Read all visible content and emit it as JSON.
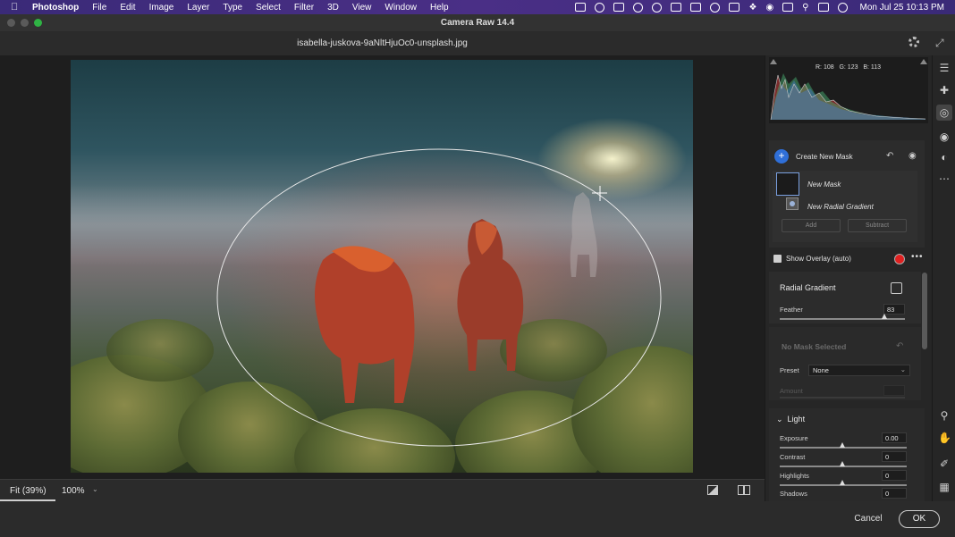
{
  "menubar": {
    "app": "Photoshop",
    "menus": [
      "File",
      "Edit",
      "Image",
      "Layer",
      "Type",
      "Select",
      "Filter",
      "3D",
      "View",
      "Window",
      "Help"
    ],
    "clock": "Mon Jul 25  10:13 PM",
    "status_icons": [
      "screen-record-icon",
      "creative-cloud-icon",
      "dropbox-icon",
      "vpn-icon",
      "sync-icon",
      "cast-icon",
      "bookmark-icon",
      "arc-icon",
      "grid-app-icon",
      "bluetooth-icon",
      "wifi-icon",
      "display-icon",
      "search-icon",
      "control-center-icon",
      "siri-icon"
    ]
  },
  "window": {
    "title": "Camera Raw 14.4",
    "filename": "isabella-juskova-9aNltHjuOc0-unsplash.jpg"
  },
  "canvas_footer": {
    "fit_label": "Fit (39%)",
    "zoom_label": "100%"
  },
  "footer": {
    "cancel": "Cancel",
    "ok": "OK"
  },
  "histogram": {
    "r": "R: 108",
    "g": "G: 123",
    "b": "B: 113"
  },
  "masks": {
    "create_label": "Create New Mask",
    "mask_name": "New Mask",
    "component_name": "New Radial Gradient",
    "add_label": "Add",
    "subtract_label": "Subtract"
  },
  "overlay": {
    "label": "Show Overlay (auto)",
    "checked": true,
    "color": "#e02020"
  },
  "radial": {
    "label": "Radial Gradient",
    "feather_label": "Feather",
    "feather_value": "83"
  },
  "nomask": {
    "header": "No Mask Selected",
    "preset_label": "Preset",
    "preset_value": "None",
    "amount_label": "Amount"
  },
  "light": {
    "header": "Light",
    "sliders": [
      {
        "label": "Exposure",
        "value": "0.00"
      },
      {
        "label": "Contrast",
        "value": "0"
      },
      {
        "label": "Highlights",
        "value": "0"
      },
      {
        "label": "Shadows",
        "value": "0"
      }
    ]
  },
  "tools": [
    "edit-sliders-icon",
    "healing-icon",
    "masking-icon",
    "red-eye-icon",
    "presets-icon",
    "more-icon",
    "zoom-icon",
    "hand-icon",
    "sampler-icon",
    "grid-icon"
  ],
  "colors": {
    "accent": "#2f6fd8",
    "panel": "#262626",
    "menubar": "#3a2a78"
  }
}
